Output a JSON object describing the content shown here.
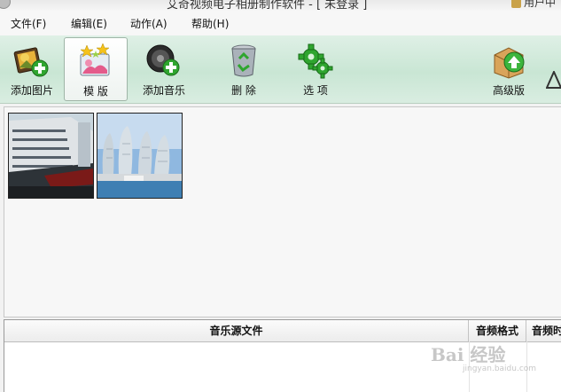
{
  "window": {
    "title": "艾奇视频电子相册制作软件 - [ 未登录 ]",
    "user_label": "用户中"
  },
  "menu": [
    {
      "label": "文件(F)"
    },
    {
      "label": "编辑(E)"
    },
    {
      "label": "动作(A)"
    },
    {
      "label": "帮助(H)"
    }
  ],
  "toolbar": {
    "add_picture": "添加图片",
    "template": "模 版",
    "add_music": "添加音乐",
    "delete": "删 除",
    "options": "选 项",
    "advanced": "高级版"
  },
  "icons": {
    "add_picture": "add-picture-icon",
    "template": "template-icon",
    "add_music": "add-music-icon",
    "delete": "recycle-bin-icon",
    "options": "gear-icon",
    "advanced": "upgrade-box-icon"
  },
  "pictures": [
    {
      "name": "cruise-ship-photo"
    },
    {
      "name": "city-hotel-photo"
    }
  ],
  "music_table": {
    "columns": [
      "音乐源文件",
      "音频格式",
      "音频时"
    ]
  },
  "watermark": {
    "text": "Bai 经验",
    "sub": "jingyan.baidu.com"
  },
  "colors": {
    "toolbar_green": "#c9e6d4",
    "icon_green": "#2fa52f"
  }
}
